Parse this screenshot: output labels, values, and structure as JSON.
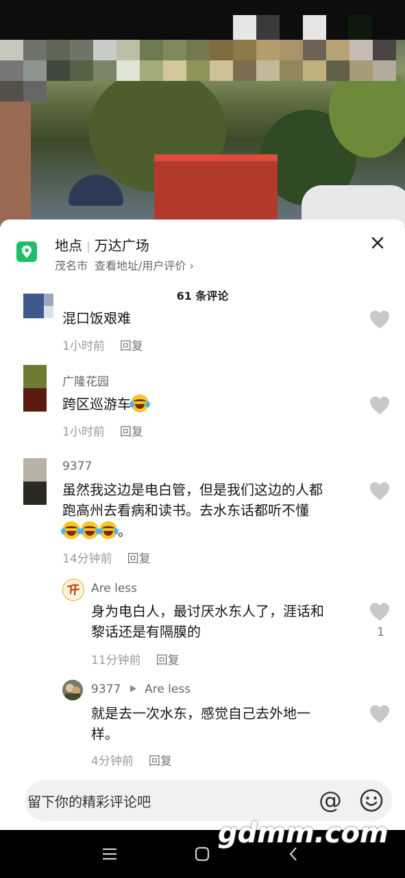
{
  "location": {
    "label": "地点",
    "name": "万达广场",
    "city": "茂名市",
    "link": "查看地址/用户评价 ›"
  },
  "comment_count": "61 条评论",
  "comments": [
    {
      "name": "",
      "text": "混口饭艰难",
      "time": "1小时前",
      "reply": "回复"
    },
    {
      "name": "广隆花园",
      "text": "跨区巡游车",
      "time": "1小时前",
      "reply": "回复"
    },
    {
      "name": "9377",
      "text_line1": "虽然我这边是电白管，但是我们这边的人都",
      "text_line2": "跑高州去看病和读书。去水东话都听不懂",
      "text_line3_end": "。",
      "time": "14分钟前",
      "reply": "回复"
    }
  ],
  "replies": [
    {
      "name": "Are less",
      "text_line1": "身为电白人，最讨厌水东人了，涯话和",
      "text_line2": "黎话还是有隔膜的",
      "time": "11分钟前",
      "reply": "回复",
      "likes": "1"
    },
    {
      "name": "9377",
      "reply_to": "Are less",
      "text_line1": "就是去一次水东，感觉自己去外地一",
      "text_line2": "样。",
      "time": "4分钟前",
      "reply": "回复"
    }
  ],
  "input": {
    "placeholder": "留下你的精彩评论吧"
  },
  "watermark": "gdmm.com",
  "colors": {
    "location_green": "#1fbf6a",
    "heart_gray": "#c8c8c8"
  }
}
